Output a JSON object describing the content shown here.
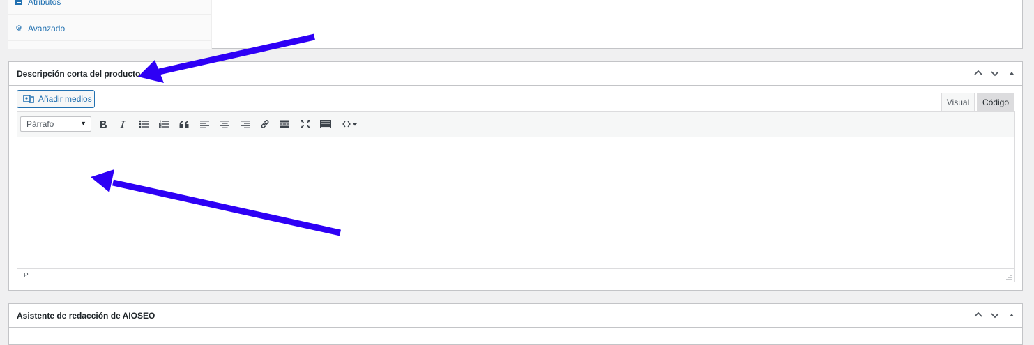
{
  "product_tabs": [
    {
      "label": "Atributos",
      "icon": "list-icon"
    },
    {
      "label": "Avanzado",
      "icon": "gear-icon"
    }
  ],
  "short_description": {
    "title": "Descripción corta del producto",
    "add_media_label": "Añadir medios",
    "tab_visual": "Visual",
    "tab_code": "Código",
    "format_select": "Párrafo",
    "status_path": "P"
  },
  "aioseo": {
    "title": "Asistente de redacción de AIOSEO"
  },
  "annotation_color": "#2e00f5"
}
